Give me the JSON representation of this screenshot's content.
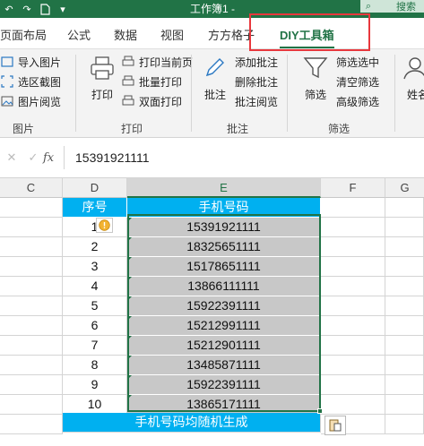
{
  "titlebar": {
    "title": "工作簿1 -",
    "search_label": "搜索"
  },
  "tabs": [
    "页面布局",
    "公式",
    "数据",
    "视图",
    "方方格子",
    "DIY工具箱"
  ],
  "active_tab": "DIY工具箱",
  "ribbon": {
    "group_picture": {
      "label": "图片",
      "items": [
        "导入图片",
        "选区截图",
        "图片阅览"
      ]
    },
    "group_print": {
      "label": "打印",
      "big_button": "打印",
      "items": [
        "打印当前页",
        "批量打印",
        "双面打印"
      ]
    },
    "group_comment": {
      "label": "批注",
      "big_button": "批注",
      "items": [
        "添加批注",
        "删除批注",
        "批注阅览"
      ]
    },
    "group_filter": {
      "label": "筛选",
      "big_button": "筛选",
      "items": [
        "筛选选中",
        "清空筛选",
        "高级筛选"
      ]
    },
    "group_name": {
      "big_button": "姓名"
    }
  },
  "formula_bar": {
    "fx": "fx",
    "value": "15391921111"
  },
  "columns": [
    "C",
    "D",
    "E",
    "F",
    "G"
  ],
  "selected_column": "E",
  "table": {
    "header_seq": "序号",
    "header_phone": "手机号码",
    "rows": [
      {
        "seq": "1",
        "phone": "15391921111"
      },
      {
        "seq": "2",
        "phone": "18325651111"
      },
      {
        "seq": "3",
        "phone": "15178651111"
      },
      {
        "seq": "4",
        "phone": "13866111111"
      },
      {
        "seq": "5",
        "phone": "15922391111"
      },
      {
        "seq": "6",
        "phone": "15212991111"
      },
      {
        "seq": "7",
        "phone": "15212901111"
      },
      {
        "seq": "8",
        "phone": "13485871111"
      },
      {
        "seq": "9",
        "phone": "15922391111"
      },
      {
        "seq": "10",
        "phone": "13865171111"
      }
    ],
    "footer": "手机号码均随机生成"
  },
  "colors": {
    "excel_green": "#217346",
    "table_blue": "#00b0f0",
    "highlight_red": "#e8383d",
    "selection_gray": "#c8c8c8"
  }
}
